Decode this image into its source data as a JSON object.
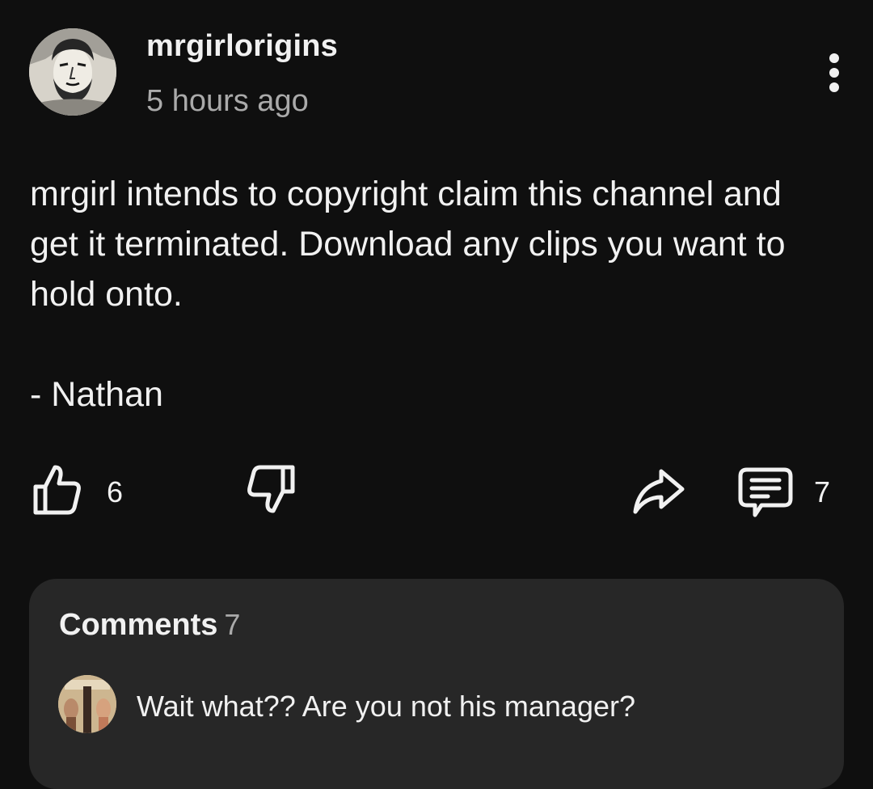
{
  "post": {
    "author": "mrgirlorigins",
    "time": "5 hours ago",
    "body_paragraph": "mrgirl intends to copyright claim this channel and get it terminated. Download any clips you want to hold onto.",
    "signature": "- Nathan",
    "like_count": "6",
    "comment_count": "7"
  },
  "icons": {
    "more": "more-vertical-icon",
    "like": "thumbs-up-icon",
    "dislike": "thumbs-down-icon",
    "share": "share-icon",
    "comment": "comment-icon"
  },
  "comments": {
    "title": "Comments",
    "count": "7",
    "first_comment": "Wait what?? Are you not his manager?"
  },
  "colors": {
    "background": "#0f0f0f",
    "panel": "#272727",
    "text": "#f1f1f1",
    "secondary_text": "#aaaaaa"
  }
}
